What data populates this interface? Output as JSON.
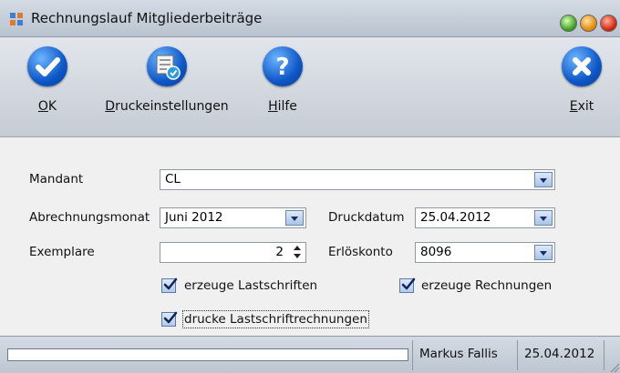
{
  "window": {
    "title": "Rechnungslauf Mitgliederbeiträge"
  },
  "toolbar": {
    "ok": {
      "accel": "O",
      "rest": "K"
    },
    "print": {
      "accel": "D",
      "rest": "ruckeinstellungen"
    },
    "help": {
      "accel": "H",
      "rest": "ilfe"
    },
    "exit": {
      "accel": "E",
      "rest": "xit"
    }
  },
  "form": {
    "mandant_label": "Mandant",
    "mandant_value": "CL",
    "abrechnungsmonat_label": "Abrechnungsmonat",
    "abrechnungsmonat_value": "Juni 2012",
    "druckdatum_label": "Druckdatum",
    "druckdatum_value": "25.04.2012",
    "exemplare_label": "Exemplare",
    "exemplare_value": "2",
    "erloeskonto_label": "Erlöskonto",
    "erloeskonto_value": "8096",
    "chk_lastschriften": {
      "label": "erzeuge Lastschriften",
      "checked": true
    },
    "chk_rechnungen": {
      "label": "erzeuge Rechnungen",
      "checked": true
    },
    "chk_drucke": {
      "label": "drucke Lastschriftrechnungen",
      "checked": true
    }
  },
  "statusbar": {
    "progress_fraction": 0,
    "user": "Markus Fallis",
    "date": "25.04.2012"
  },
  "colors": {
    "accent_blue": "#0d57c7",
    "titlebar": "#c6ced9",
    "form_background": "#f0f0f0"
  },
  "icons": [
    "app-grid-icon",
    "checkmark-icon",
    "printer-settings-icon",
    "question-mark-icon",
    "close-x-icon",
    "check-icon"
  ]
}
